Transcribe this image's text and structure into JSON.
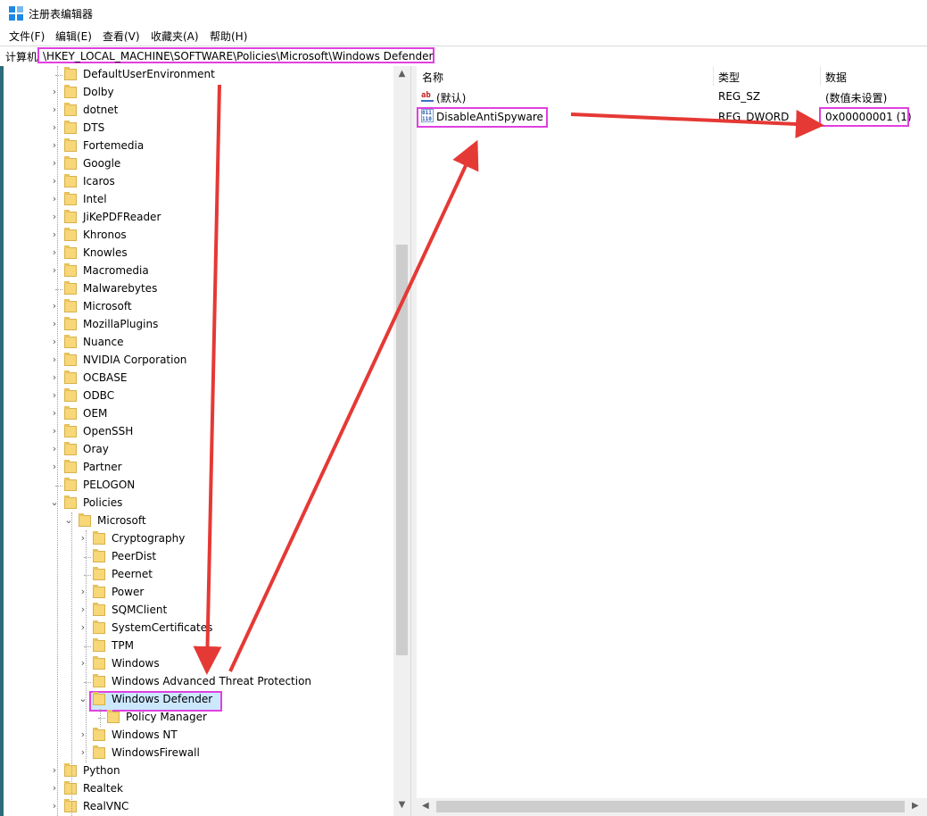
{
  "window": {
    "title": "注册表编辑器"
  },
  "menu": [
    "文件(F)",
    "编辑(E)",
    "查看(V)",
    "收藏夹(A)",
    "帮助(H)"
  ],
  "address": {
    "label": "计算机",
    "path": "\\HKEY_LOCAL_MACHINE\\SOFTWARE\\Policies\\Microsoft\\Windows Defender"
  },
  "tree": [
    {
      "label": "DefaultUserEnvironment",
      "level": 0,
      "expander": "none"
    },
    {
      "label": "Dolby",
      "level": 0,
      "expander": "collapsed"
    },
    {
      "label": "dotnet",
      "level": 0,
      "expander": "collapsed"
    },
    {
      "label": "DTS",
      "level": 0,
      "expander": "collapsed"
    },
    {
      "label": "Fortemedia",
      "level": 0,
      "expander": "collapsed"
    },
    {
      "label": "Google",
      "level": 0,
      "expander": "collapsed"
    },
    {
      "label": "Icaros",
      "level": 0,
      "expander": "collapsed"
    },
    {
      "label": "Intel",
      "level": 0,
      "expander": "collapsed"
    },
    {
      "label": "JiKePDFReader",
      "level": 0,
      "expander": "collapsed"
    },
    {
      "label": "Khronos",
      "level": 0,
      "expander": "collapsed"
    },
    {
      "label": "Knowles",
      "level": 0,
      "expander": "collapsed"
    },
    {
      "label": "Macromedia",
      "level": 0,
      "expander": "collapsed"
    },
    {
      "label": "Malwarebytes",
      "level": 0,
      "expander": "none"
    },
    {
      "label": "Microsoft",
      "level": 0,
      "expander": "collapsed"
    },
    {
      "label": "MozillaPlugins",
      "level": 0,
      "expander": "collapsed"
    },
    {
      "label": "Nuance",
      "level": 0,
      "expander": "collapsed"
    },
    {
      "label": "NVIDIA Corporation",
      "level": 0,
      "expander": "collapsed"
    },
    {
      "label": "OCBASE",
      "level": 0,
      "expander": "collapsed"
    },
    {
      "label": "ODBC",
      "level": 0,
      "expander": "collapsed"
    },
    {
      "label": "OEM",
      "level": 0,
      "expander": "collapsed"
    },
    {
      "label": "OpenSSH",
      "level": 0,
      "expander": "collapsed"
    },
    {
      "label": "Oray",
      "level": 0,
      "expander": "collapsed"
    },
    {
      "label": "Partner",
      "level": 0,
      "expander": "collapsed"
    },
    {
      "label": "PELOGON",
      "level": 0,
      "expander": "none"
    },
    {
      "label": "Policies",
      "level": 0,
      "expander": "expanded"
    },
    {
      "label": "Microsoft",
      "level": 1,
      "expander": "expanded"
    },
    {
      "label": "Cryptography",
      "level": 2,
      "expander": "collapsed"
    },
    {
      "label": "PeerDist",
      "level": 2,
      "expander": "none"
    },
    {
      "label": "Peernet",
      "level": 2,
      "expander": "none"
    },
    {
      "label": "Power",
      "level": 2,
      "expander": "collapsed"
    },
    {
      "label": "SQMClient",
      "level": 2,
      "expander": "collapsed"
    },
    {
      "label": "SystemCertificates",
      "level": 2,
      "expander": "collapsed"
    },
    {
      "label": "TPM",
      "level": 2,
      "expander": "none"
    },
    {
      "label": "Windows",
      "level": 2,
      "expander": "collapsed"
    },
    {
      "label": "Windows Advanced Threat Protection",
      "level": 2,
      "expander": "none"
    },
    {
      "label": "Windows Defender",
      "level": 2,
      "expander": "expanded",
      "selected": true
    },
    {
      "label": "Policy Manager",
      "level": 3,
      "expander": "none"
    },
    {
      "label": "Windows NT",
      "level": 2,
      "expander": "collapsed"
    },
    {
      "label": "WindowsFirewall",
      "level": 2,
      "expander": "collapsed"
    },
    {
      "label": "Python",
      "level": 0,
      "expander": "collapsed"
    },
    {
      "label": "Realtek",
      "level": 0,
      "expander": "collapsed"
    },
    {
      "label": "RealVNC",
      "level": 0,
      "expander": "collapsed"
    }
  ],
  "list": {
    "columns": [
      "名称",
      "类型",
      "数据"
    ],
    "rows": [
      {
        "icon": "string-value-icon",
        "name": "(默认)",
        "type": "REG_SZ",
        "data": "(数值未设置)"
      },
      {
        "icon": "dword-value-icon",
        "name": "DisableAntiSpyware",
        "type": "REG_DWORD",
        "data": "0x00000001 (1)"
      }
    ]
  },
  "colors": {
    "highlight": "#e040e0",
    "arrow": "#e53935",
    "selection": "#cce8ff"
  },
  "icons": {
    "app": "registry-editor-icon",
    "up": "scroll-up-arrow-icon",
    "down": "scroll-down-arrow-icon",
    "left": "scroll-left-arrow-icon",
    "right": "scroll-right-arrow-icon"
  }
}
